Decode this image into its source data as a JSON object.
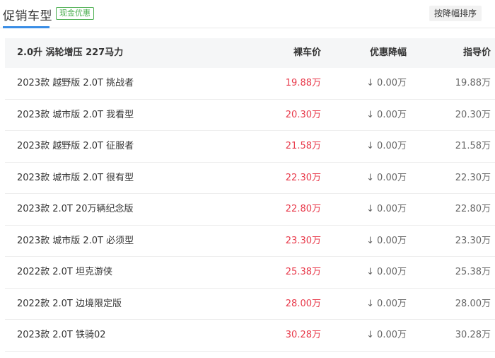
{
  "header": {
    "tab_title": "促销车型",
    "badge": "现金优惠",
    "sort_button": "按降幅排序"
  },
  "table": {
    "headers": {
      "name": "2.0升 涡轮增压 227马力",
      "price": "裸车价",
      "discount": "优惠降幅",
      "guide": "指导价"
    },
    "rows": [
      {
        "name": "2023款 越野版 2.0T 挑战者",
        "price": "19.88万",
        "discount": "0.00万",
        "guide": "19.88万"
      },
      {
        "name": "2023款 城市版 2.0T 我看型",
        "price": "20.30万",
        "discount": "0.00万",
        "guide": "20.30万"
      },
      {
        "name": "2023款 越野版 2.0T 征服者",
        "price": "21.58万",
        "discount": "0.00万",
        "guide": "21.58万"
      },
      {
        "name": "2023款 城市版 2.0T 很有型",
        "price": "22.30万",
        "discount": "0.00万",
        "guide": "22.30万"
      },
      {
        "name": "2023款 2.0T 20万辆纪念版",
        "price": "22.80万",
        "discount": "0.00万",
        "guide": "22.80万"
      },
      {
        "name": "2023款 城市版 2.0T 必须型",
        "price": "23.30万",
        "discount": "0.00万",
        "guide": "23.30万"
      },
      {
        "name": "2022款 2.0T 坦克游侠",
        "price": "25.38万",
        "discount": "0.00万",
        "guide": "25.38万"
      },
      {
        "name": "2022款 2.0T 边境限定版",
        "price": "28.00万",
        "discount": "0.00万",
        "guide": "28.00万"
      },
      {
        "name": "2023款 2.0T 铁骑02",
        "price": "30.28万",
        "discount": "0.00万",
        "guide": "30.28万"
      }
    ]
  },
  "colors": {
    "accent": "#3a8ee6",
    "price": "#e8394a",
    "badge": "#4caf50"
  },
  "icons": {
    "discount_arrow": "arrow-down-icon"
  }
}
